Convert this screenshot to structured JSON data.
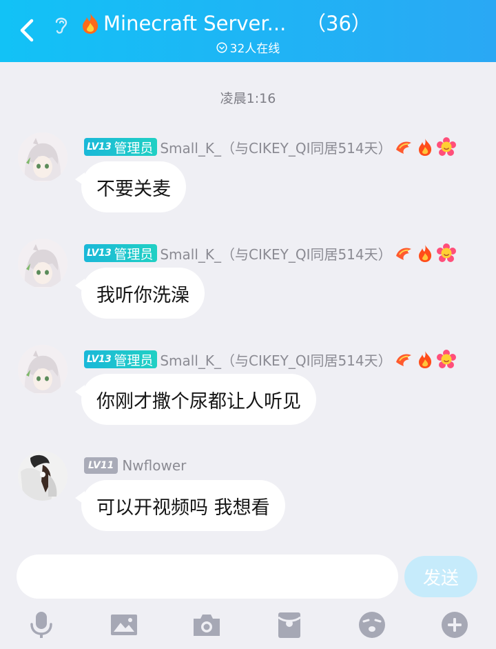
{
  "header": {
    "back_icon": "chevron-left-icon",
    "ear_icon": "ear-icon",
    "title_icon": "fire-icon",
    "title": "Minecraft Server...",
    "member_count": "（36）",
    "online_text": "32人在线",
    "colors": {
      "gradient_start": "#12c2f6",
      "gradient_end": "#2aa8f4"
    }
  },
  "chat": {
    "timestamp": "凌晨1:16",
    "messages": [
      {
        "level": "LV13",
        "role": "管理员",
        "sender": "Small_K_（与CIKEY_QI同居514天）",
        "text": "不要关麦"
      },
      {
        "level": "LV13",
        "role": "管理员",
        "sender": "Small_K_（与CIKEY_QI同居514天）",
        "text": "我听你洗澡"
      },
      {
        "level": "LV13",
        "role": "管理员",
        "sender": "Small_K_（与CIKEY_QI同居514天）",
        "text": "你刚才撒个尿都让人听见"
      },
      {
        "level": "LV11",
        "role": "",
        "sender": "Nwflower",
        "text": "可以开视频吗 我想看"
      }
    ]
  },
  "composer": {
    "input_value": "",
    "send_label": "发送"
  },
  "toolbar": {
    "items": [
      "microphone-icon",
      "image-icon",
      "camera-icon",
      "red-packet-icon",
      "emoji-icon",
      "plus-icon"
    ]
  }
}
